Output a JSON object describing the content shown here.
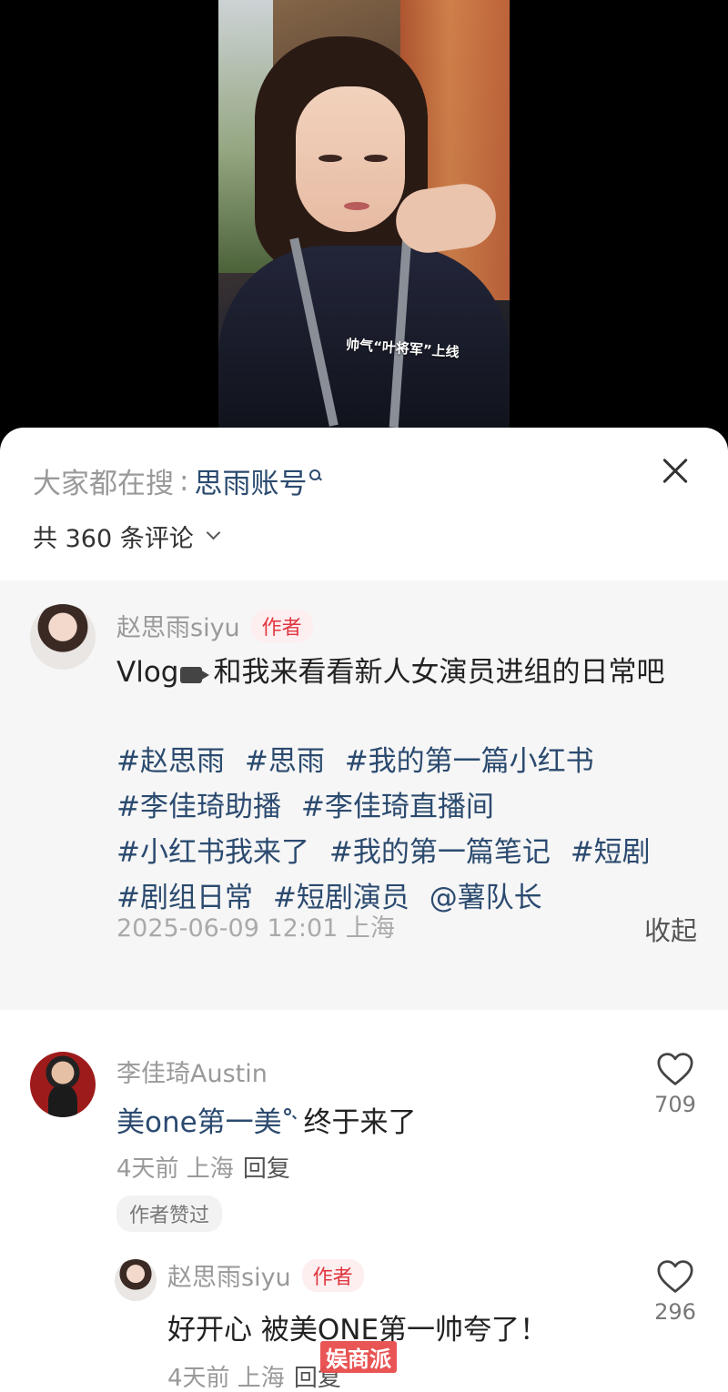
{
  "video": {
    "caption": "帅气“叶将军”上线"
  },
  "sheet": {
    "search_prefix": "大家都在搜",
    "search_separator": ":",
    "search_term": "思雨账号",
    "comment_count_label": "共 360 条评论"
  },
  "post": {
    "author_name": "赵思雨siyu",
    "author_badge": "作者",
    "text_before_icon": "Vlog",
    "text_after_icon": "和我来看看新人女演员进组的日常吧",
    "tags": [
      "#赵思雨",
      "#思雨",
      "#我的第一篇小红书",
      "#李佳琦助播",
      "#李佳琦直播间",
      "#小红书我来了",
      "#我的第一篇笔记",
      "#短剧",
      "#剧组日常",
      "#短剧演员",
      "@薯队长"
    ],
    "meta": "2025-06-09 12:01 上海",
    "collapse_label": "收起"
  },
  "comments": [
    {
      "name": "李佳琦Austin",
      "text_link": "美one第一美",
      "text_rest": " 终于来了",
      "time_location": "4天前 上海",
      "reply_label": "回复",
      "liked_tag": "作者赞过",
      "like_count": "709"
    },
    {
      "name": "赵思雨siyu",
      "badge": "作者",
      "text": "好开心 被美ONE第一帅夸了！",
      "time_location": "4天前 上海",
      "reply_label": "回复",
      "like_count": "296"
    }
  ],
  "watermark": "娱商派",
  "colors": {
    "link": "#2b4a6f",
    "badge_bg": "#fdeef0",
    "badge_text": "#e0363f",
    "post_bg": "#f6f6f6"
  }
}
